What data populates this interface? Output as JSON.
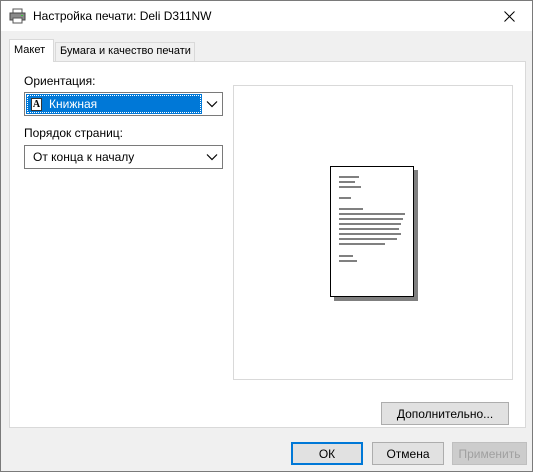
{
  "window": {
    "title": "Настройка печати: Deli D311NW",
    "icon": "printer-icon",
    "close_icon": "close-icon"
  },
  "tabs": [
    {
      "label": "Макет",
      "active": true
    },
    {
      "label": "Бумага и качество печати",
      "active": false
    }
  ],
  "layout": {
    "orientation_label": "Ориентация:",
    "orientation_value": "Книжная",
    "orientation_glyph": "A",
    "page_order_label": "Порядок страниц:",
    "page_order_value": "От конца к началу"
  },
  "advanced_button": "Дополнительно...",
  "footer": {
    "ok": "ОК",
    "cancel": "Отмена",
    "apply": "Применить"
  },
  "colors": {
    "selection": "#0078d7",
    "panel": "#ffffff",
    "window": "#f0f0f0"
  }
}
